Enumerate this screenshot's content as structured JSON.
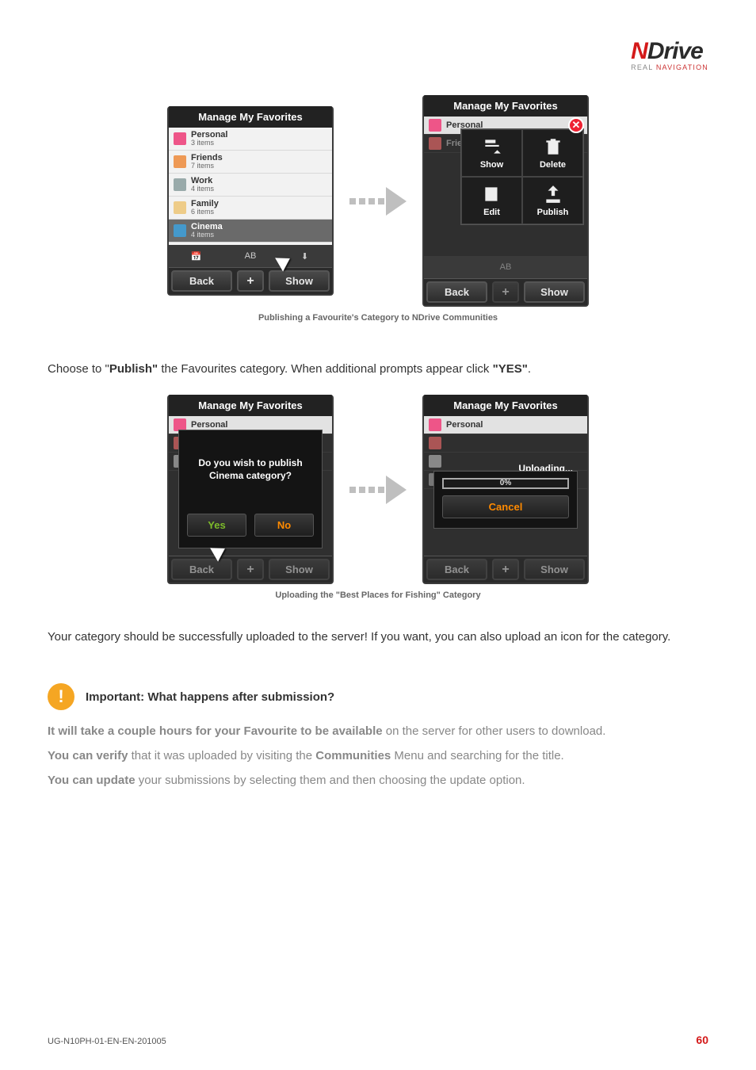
{
  "brand": {
    "prefix": "N",
    "rest": "Drive",
    "tagline_a": "REAL",
    "tagline_b": "NAVIGATION"
  },
  "figure1": {
    "left": {
      "title": "Manage My Favorites",
      "items": [
        {
          "label": "Personal",
          "count": "3 items"
        },
        {
          "label": "Friends",
          "count": "7 items"
        },
        {
          "label": "Work",
          "count": "4 items"
        },
        {
          "label": "Family",
          "count": "6 items"
        },
        {
          "label": "Cinema",
          "count": "4 items",
          "selected": true
        }
      ],
      "strip": {
        "a": "📅",
        "b": "AB",
        "c": "⬇"
      },
      "nav": {
        "back": "Back",
        "plus": "+",
        "show": "Show"
      }
    },
    "right": {
      "title": "Manage My Favorites",
      "ghost_items": [
        {
          "label": "Personal"
        },
        {
          "label": "Friends"
        },
        {
          "label": ""
        },
        {
          "label": ""
        },
        {
          "label": ""
        }
      ],
      "overlay": {
        "show": "Show",
        "delete": "Delete",
        "edit": "Edit",
        "publish": "Publish"
      },
      "strip": {
        "a": "",
        "b": "AB",
        "c": ""
      },
      "nav": {
        "back": "Back",
        "plus": "+",
        "show": "Show"
      }
    },
    "caption": "Publishing a Favourite's Category to NDrive Communities"
  },
  "para1": {
    "a": "Choose to \"",
    "b": "Publish\"",
    "c": " the Favourites category. When additional prompts appear click ",
    "d": "\"YES\"",
    "e": "."
  },
  "figure2": {
    "left": {
      "title": "Manage My Favorites",
      "popup_line1": "Do you wish to publish",
      "popup_line2": "Cinema category?",
      "yes": "Yes",
      "no": "No",
      "nav": {
        "back": "Back",
        "plus": "+",
        "show": "Show"
      }
    },
    "right": {
      "title": "Manage My Favorites",
      "uploading": "Uploading...",
      "percent": "0%",
      "cancel": "Cancel",
      "nav": {
        "back": "Back",
        "plus": "+",
        "show": "Show"
      }
    },
    "caption": "Uploading the \"Best Places for Fishing\" Category"
  },
  "para2": "Your category should be successfully uploaded to the server! If you want, you can also upload an icon for the category.",
  "important": {
    "title": "Important: What happens after submission?",
    "p1a": "It will take a couple hours for your Favourite to be available",
    "p1b": " on the server for other users to download.",
    "p2a": "You can verify",
    "p2b": " that it was uploaded by visiting the ",
    "p2c": "Communities",
    "p2d": " Menu and searching for the title.",
    "p3a": "You can update",
    "p3b": " your submissions by selecting them and then choosing the update option."
  },
  "footer": {
    "doc": "UG-N10PH-01-EN-EN-201005",
    "page": "60"
  }
}
